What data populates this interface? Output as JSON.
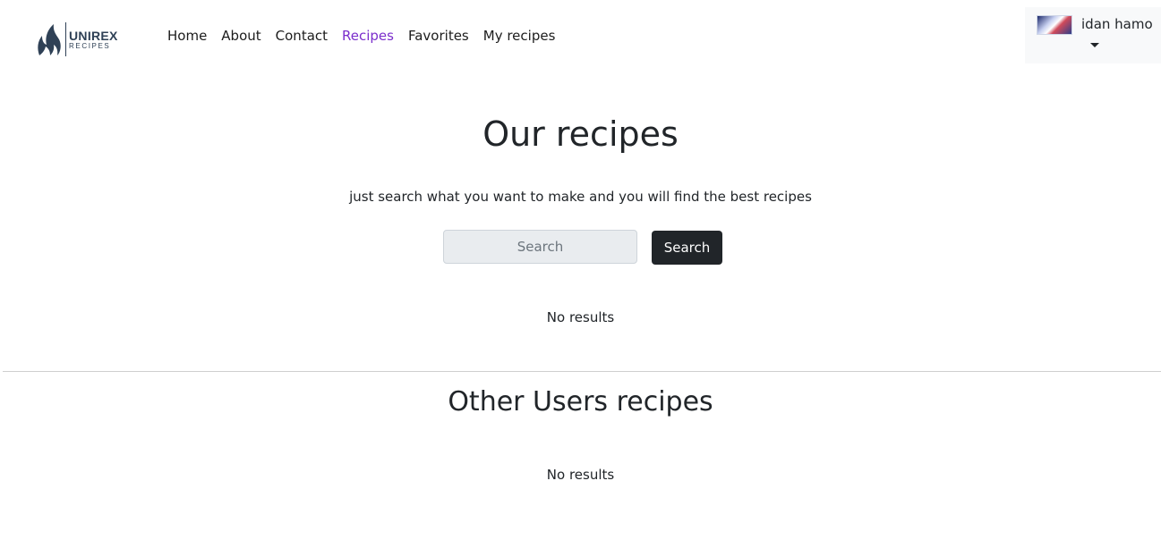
{
  "brand": {
    "name": "UNIREX",
    "subtitle": "RECIPES",
    "logo_icon": "flame-logo-icon",
    "color": "#2f4156"
  },
  "nav": {
    "items": [
      {
        "label": "Home",
        "active": false
      },
      {
        "label": "About",
        "active": false
      },
      {
        "label": "Contact",
        "active": false
      },
      {
        "label": "Recipes",
        "active": true
      },
      {
        "label": "Favorites",
        "active": false
      },
      {
        "label": "My recipes",
        "active": false
      }
    ],
    "active_color": "#7b2ecc"
  },
  "user": {
    "name": "idan hamo",
    "avatar_icon": "avatar-image",
    "dropdown_icon": "caret-down-icon"
  },
  "main": {
    "title": "Our recipes",
    "subtitle": "just search what you want to make and you will find the best recipes",
    "search": {
      "placeholder": "Search",
      "value": "",
      "button_label": "Search"
    },
    "results_text": "No results"
  },
  "other_users": {
    "title": "Other Users recipes",
    "results_text": "No results"
  }
}
